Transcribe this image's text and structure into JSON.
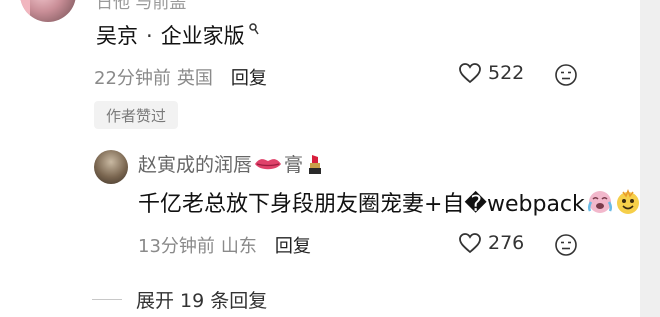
{
  "top_partial_text": "日他 与前盖",
  "main_comment": {
    "author": "吴京",
    "separator": "·",
    "author_suffix": "企业家版",
    "time": "22分钟前",
    "location": "英国",
    "reply_label": "回复",
    "likes": "522",
    "badge": "作者赞过"
  },
  "sub_comment": {
    "author": "赵寅成的润唇",
    "author_suffix": "膏",
    "content": "千亿老总放下身段朋友圈宠妻+自�webpack",
    "time": "13分钟前",
    "location": "山东",
    "reply_label": "回复",
    "likes": "276"
  },
  "expand_label": "展开 19 条回复",
  "icons": [
    "heart-icon",
    "emoji-face-icon",
    "lips-icon",
    "lipstick-icon",
    "crying-laugh-emoji",
    "mocking-emoji"
  ],
  "colors": {
    "meta_gray": "#8a8a8a",
    "pill_bg": "#f2f2f2",
    "scrollbar": "#efefef"
  }
}
